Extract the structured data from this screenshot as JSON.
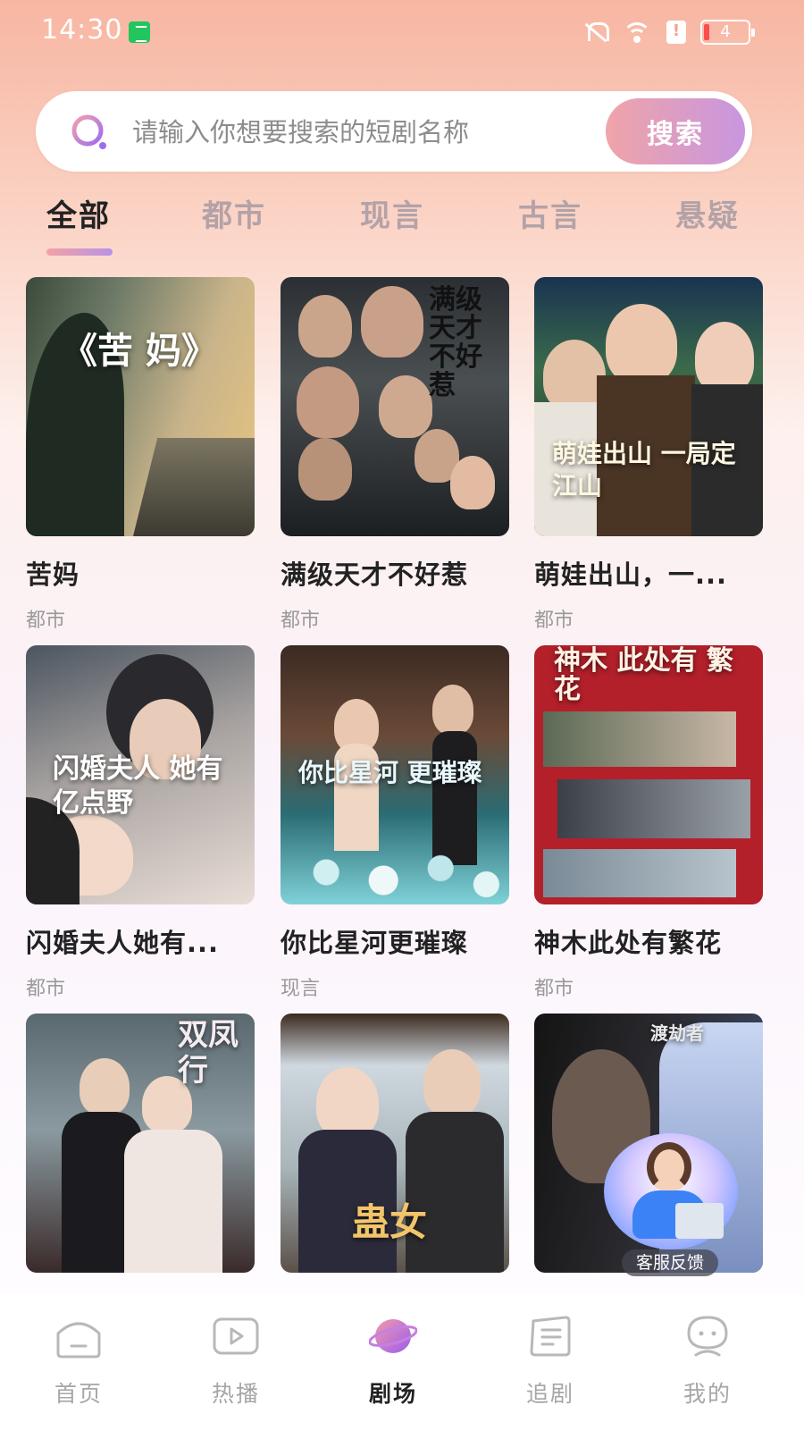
{
  "status_bar": {
    "time": "14:30",
    "battery": "4"
  },
  "search": {
    "placeholder": "请输入你想要搜索的短剧名称",
    "button_label": "搜索"
  },
  "tabs": [
    {
      "label": "全部",
      "active": true
    },
    {
      "label": "都市",
      "active": false
    },
    {
      "label": "现言",
      "active": false
    },
    {
      "label": "古言",
      "active": false
    },
    {
      "label": "悬疑",
      "active": false
    }
  ],
  "dramas": [
    {
      "title": "苦妈",
      "genre": "都市",
      "poster_text": "《苦 妈》"
    },
    {
      "title": "满级天才不好惹",
      "genre": "都市",
      "poster_text": "满级天才不好惹"
    },
    {
      "title": "萌娃出山，一...",
      "genre": "都市",
      "poster_text": "萌娃出山 一局定江山"
    },
    {
      "title": "闪婚夫人她有...",
      "genre": "都市",
      "poster_text": "闪婚夫人 她有亿点野"
    },
    {
      "title": "你比星河更璀璨",
      "genre": "现言",
      "poster_text": "你比星河 更璀璨"
    },
    {
      "title": "神木此处有繁花",
      "genre": "都市",
      "poster_text": "神木 此处有 繁花"
    },
    {
      "title": "",
      "genre": "",
      "poster_text": "双凤行"
    },
    {
      "title": "",
      "genre": "",
      "poster_text": "蛊女"
    },
    {
      "title": "",
      "genre": "",
      "poster_text": "渡劫者"
    }
  ],
  "customer_service": {
    "label": "客服反馈"
  },
  "bottom_nav": [
    {
      "label": "首页",
      "icon": "home-icon",
      "active": false
    },
    {
      "label": "热播",
      "icon": "play-icon",
      "active": false
    },
    {
      "label": "剧场",
      "icon": "planet-icon",
      "active": true
    },
    {
      "label": "追剧",
      "icon": "list-icon",
      "active": false
    },
    {
      "label": "我的",
      "icon": "profile-icon",
      "active": false
    }
  ]
}
